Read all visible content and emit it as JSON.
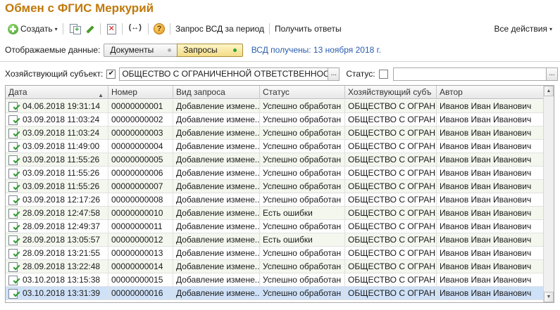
{
  "window": {
    "title": "Обмен с ФГИС Меркурий"
  },
  "toolbar": {
    "create_label": "Создать",
    "request_vsd_label": "Запрос ВСД за период",
    "get_answers_label": "Получить ответы",
    "all_actions_label": "Все действия",
    "caret": "▾",
    "exchange_glyph": "(↔)",
    "help_glyph": "?"
  },
  "display": {
    "label": "Отображаемые данные:",
    "options": [
      "Документы",
      "Запросы"
    ],
    "selected": "Запросы",
    "vsd_status": "ВСД получены: 13 ноября 2018 г."
  },
  "filter": {
    "subject_label": "Хозяйствующий субъект:",
    "subject_checked": true,
    "subject_value": "ОБЩЕСТВО С ОГРАНИЧЕННОЙ ОТВЕТСТВЕННОСТЬЮ \"",
    "status_label": "Статус:",
    "status_checked": false,
    "status_value": "",
    "ellipsis": "..."
  },
  "table": {
    "columns": [
      "Дата",
      "Номер",
      "Вид запроса",
      "Статус",
      "Хозяйствующий субъ",
      "Автор"
    ],
    "rows": [
      [
        "04.06.2018 19:31:14",
        "00000000001",
        "Добавление измене...",
        "Успешно обработан",
        "ОБЩЕСТВО С ОГРАН...",
        "Иванов Иван Иванович"
      ],
      [
        "03.09.2018 11:03:24",
        "00000000002",
        "Добавление измене...",
        "Успешно обработан",
        "ОБЩЕСТВО С ОГРАН...",
        "Иванов Иван Иванович"
      ],
      [
        "03.09.2018 11:03:24",
        "00000000003",
        "Добавление измене...",
        "Успешно обработан",
        "ОБЩЕСТВО С ОГРАН...",
        "Иванов Иван Иванович"
      ],
      [
        "03.09.2018 11:49:00",
        "00000000004",
        "Добавление измене...",
        "Успешно обработан",
        "ОБЩЕСТВО С ОГРАН...",
        "Иванов Иван Иванович"
      ],
      [
        "03.09.2018 11:55:26",
        "00000000005",
        "Добавление измене...",
        "Успешно обработан",
        "ОБЩЕСТВО С ОГРАН...",
        "Иванов Иван Иванович"
      ],
      [
        "03.09.2018 11:55:26",
        "00000000006",
        "Добавление измене...",
        "Успешно обработан",
        "ОБЩЕСТВО С ОГРАН...",
        "Иванов Иван Иванович"
      ],
      [
        "03.09.2018 11:55:26",
        "00000000007",
        "Добавление измене...",
        "Успешно обработан",
        "ОБЩЕСТВО С ОГРАН...",
        "Иванов Иван Иванович"
      ],
      [
        "03.09.2018 12:17:26",
        "00000000008",
        "Добавление измене...",
        "Успешно обработан",
        "ОБЩЕСТВО С ОГРАН...",
        "Иванов Иван Иванович"
      ],
      [
        "28.09.2018 12:47:58",
        "00000000010",
        "Добавление измене...",
        "Есть ошибки",
        "ОБЩЕСТВО С ОГРАН...",
        "Иванов Иван Иванович"
      ],
      [
        "28.09.2018 12:49:37",
        "00000000011",
        "Добавление измене...",
        "Успешно обработан",
        "ОБЩЕСТВО С ОГРАН...",
        "Иванов Иван Иванович"
      ],
      [
        "28.09.2018 13:05:57",
        "00000000012",
        "Добавление измене...",
        "Есть ошибки",
        "ОБЩЕСТВО С ОГРАН...",
        "Иванов Иван Иванович"
      ],
      [
        "28.09.2018 13:21:55",
        "00000000013",
        "Добавление измене...",
        "Успешно обработан",
        "ОБЩЕСТВО С ОГРАН...",
        "Иванов Иван Иванович"
      ],
      [
        "28.09.2018 13:22:48",
        "00000000014",
        "Добавление измене...",
        "Успешно обработан",
        "ОБЩЕСТВО С ОГРАН...",
        "Иванов Иван Иванович"
      ],
      [
        "03.10.2018 13:15:38",
        "00000000015",
        "Добавление измене...",
        "Успешно обработан",
        "ОБЩЕСТВО С ОГРАН...",
        "Иванов Иван Иванович"
      ],
      [
        "03.10.2018 13:31:39",
        "00000000016",
        "Добавление измене...",
        "Успешно обработан",
        "ОБЩЕСТВО С ОГРАН...",
        "Иванов Иван Иванович"
      ]
    ],
    "selected_row": 14,
    "sort_glyph": "▲"
  },
  "colors": {
    "title": "#c0790a",
    "link": "#2a5db0",
    "selection": "#cfe1f7",
    "create_icon": "#3a9a22"
  },
  "icons": [
    "create-icon",
    "copy-icon",
    "edit-icon",
    "delete-icon",
    "exchange-icon",
    "help-icon",
    "document-check-icon",
    "sort-asc-icon",
    "checkbox-icon"
  ]
}
